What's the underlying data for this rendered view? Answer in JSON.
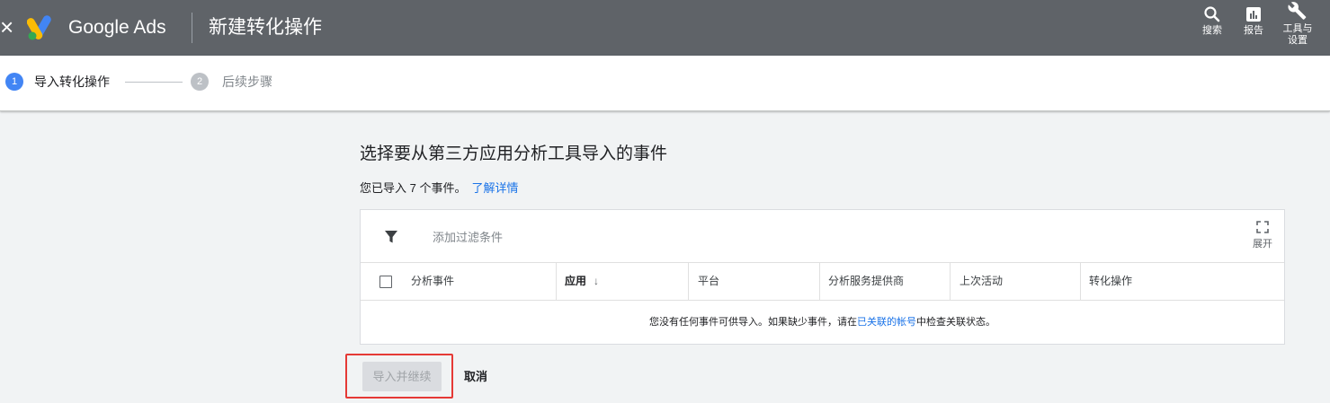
{
  "topbar": {
    "brand": "Google Ads",
    "page_title": "新建转化操作",
    "tools": {
      "search": "搜索",
      "report": "报告",
      "settings_line1": "工具与",
      "settings_line2": "设置"
    }
  },
  "stepper": {
    "steps": [
      {
        "number": "1",
        "label": "导入转化操作",
        "state": "active"
      },
      {
        "number": "2",
        "label": "后续步骤",
        "state": "inactive"
      }
    ]
  },
  "main": {
    "title": "选择要从第三方应用分析工具导入的事件",
    "subtitle": "您已导入 7 个事件。",
    "learn_more": "了解详情"
  },
  "table": {
    "filter_placeholder": "添加过滤条件",
    "expand_label": "展开",
    "columns": [
      "分析事件",
      "应用",
      "平台",
      "分析服务提供商",
      "上次活动",
      "转化操作"
    ],
    "sort_indicator": "↓",
    "empty_message": {
      "before": "您没有任何事件可供导入。如果缺少事件，请在",
      "link": "已关联的帐号",
      "after": "中检查关联状态。"
    }
  },
  "actions": {
    "primary": "导入并继续",
    "cancel": "取消"
  },
  "colors": {
    "topbar_bg": "#5f6368",
    "accent_blue": "#1a73e8",
    "step_active": "#4285f4",
    "highlight_red": "#e53935"
  },
  "icons": {
    "close": "close-icon",
    "logo": "google-ads-logo",
    "search": "search-icon",
    "report": "bar-chart-icon",
    "settings": "wrench-icon",
    "filter": "filter-icon",
    "expand": "fullscreen-icon"
  }
}
